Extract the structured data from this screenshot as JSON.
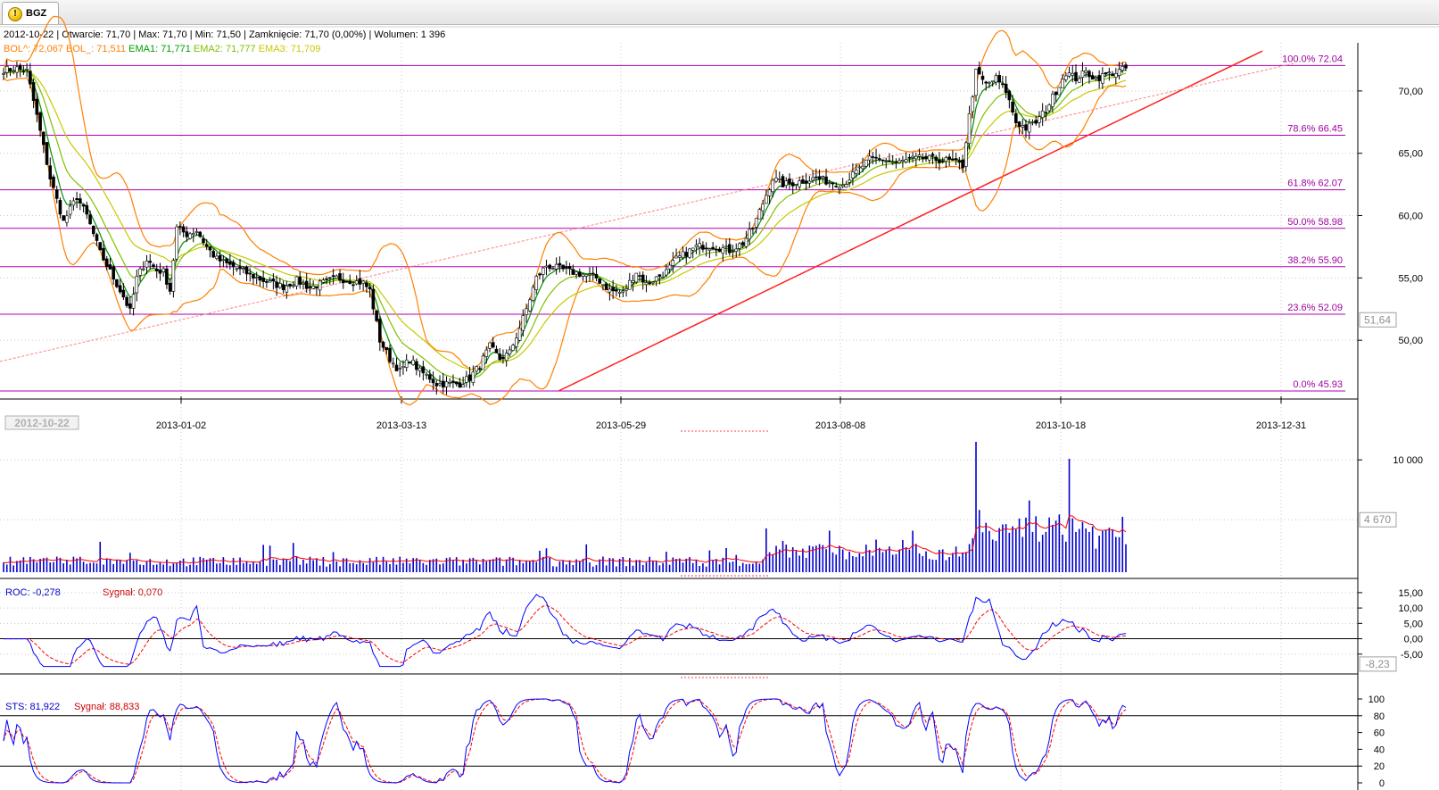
{
  "tab": {
    "label": "BGZ",
    "icon": "warning-icon"
  },
  "quote_line": "2012-10-22 | Otwarcie: 71,70 | Max: 71,70 | Min: 71,50 | Zamknięcie: 71,70 (0,00%) | Wolumen: 1 396",
  "indicators": [
    {
      "text": "BOL^: 72,067",
      "color": "#ff8000"
    },
    {
      "text": "BOL_: 71,511",
      "color": "#ff8000"
    },
    {
      "text": "EMA1: 71,771",
      "color": "#00a000"
    },
    {
      "text": "EMA2: 71,777",
      "color": "#80c000"
    },
    {
      "text": "EMA3: 71,709",
      "color": "#c8c800"
    }
  ],
  "roc_legend": {
    "roc": "ROC: -0,278",
    "signal": "Sygnał: 0,070"
  },
  "sts_legend": {
    "sts": "STS: 81,922",
    "signal": "Sygnał: 88,833"
  },
  "date_badge": "2012-10-22",
  "chart_data": [
    {
      "type": "candlestick",
      "title": "BGZ",
      "x_tick_labels": [
        "2013-01-02",
        "2013-03-13",
        "2013-05-29",
        "2013-08-08",
        "2013-10-18",
        "2013-12-31"
      ],
      "y_tick_labels": [
        "50,00",
        "55,00",
        "60,00",
        "65,00",
        "70,00"
      ],
      "ylim": [
        45.5,
        73.5
      ],
      "current_value_label": "51,64",
      "current_value": 51.64,
      "fibonacci_levels": [
        {
          "label": "100.0% 72.04",
          "value": 72.04
        },
        {
          "label": "78.6% 66.45",
          "value": 66.45
        },
        {
          "label": "61.8% 62.07",
          "value": 62.07
        },
        {
          "label": "50.0% 58.98",
          "value": 58.98
        },
        {
          "label": "38.2% 55.90",
          "value": 55.9
        },
        {
          "label": "23.6% 52.09",
          "value": 52.09
        },
        {
          "label": "0.0% 45.93",
          "value": 45.93
        }
      ],
      "close_keypoints": [
        [
          0,
          71.7
        ],
        [
          4,
          71.8
        ],
        [
          7,
          71.6
        ],
        [
          10,
          68
        ],
        [
          14,
          63
        ],
        [
          18,
          59.5
        ],
        [
          22,
          61.5
        ],
        [
          25,
          60
        ],
        [
          29,
          57
        ],
        [
          32,
          55.5
        ],
        [
          36,
          53.5
        ],
        [
          38,
          52.3
        ],
        [
          40,
          55
        ],
        [
          43,
          56.5
        ],
        [
          46,
          55.6
        ],
        [
          48,
          55.5
        ],
        [
          50,
          54
        ],
        [
          52,
          59
        ],
        [
          55,
          58.5
        ],
        [
          58,
          58.8
        ],
        [
          61,
          57.5
        ],
        [
          64,
          56.5
        ],
        [
          68,
          56
        ],
        [
          72,
          55.5
        ],
        [
          76,
          55
        ],
        [
          80,
          54.6
        ],
        [
          84,
          54.3
        ],
        [
          88,
          54.8
        ],
        [
          92,
          54.2
        ],
        [
          96,
          54.6
        ],
        [
          100,
          55
        ],
        [
          104,
          54.8
        ],
        [
          108,
          54.6
        ],
        [
          110,
          54
        ],
        [
          113,
          50
        ],
        [
          116,
          48.5
        ],
        [
          119,
          47.5
        ],
        [
          122,
          48.5
        ],
        [
          125,
          47.5
        ],
        [
          128,
          47
        ],
        [
          130,
          46.5
        ],
        [
          134,
          46.5
        ],
        [
          137,
          46.5
        ],
        [
          140,
          47
        ],
        [
          143,
          48
        ],
        [
          146,
          49.5
        ],
        [
          149,
          48.5
        ],
        [
          152,
          49
        ],
        [
          155,
          51
        ],
        [
          157,
          52.5
        ],
        [
          160,
          55
        ],
        [
          163,
          56
        ],
        [
          166,
          55.8
        ],
        [
          170,
          55.5
        ],
        [
          174,
          55.3
        ],
        [
          178,
          55
        ],
        [
          182,
          54
        ],
        [
          186,
          53.8
        ],
        [
          190,
          55.5
        ],
        [
          193,
          54.5
        ],
        [
          196,
          55
        ],
        [
          199,
          55.5
        ],
        [
          202,
          56.5
        ],
        [
          205,
          57
        ],
        [
          208,
          57.5
        ],
        [
          211,
          57.6
        ],
        [
          214,
          57.5
        ],
        [
          218,
          57.2
        ],
        [
          222,
          57.8
        ],
        [
          225,
          59
        ],
        [
          228,
          61
        ],
        [
          231,
          63
        ],
        [
          234,
          62.5
        ],
        [
          237,
          62.6
        ],
        [
          240,
          62.8
        ],
        [
          244,
          63
        ],
        [
          248,
          62.7
        ],
        [
          252,
          62.5
        ],
        [
          256,
          63.5
        ],
        [
          260,
          64.5
        ],
        [
          264,
          64.5
        ],
        [
          268,
          64.2
        ],
        [
          272,
          64.5
        ],
        [
          276,
          64.6
        ],
        [
          280,
          64.5
        ],
        [
          284,
          64.4
        ],
        [
          288,
          64
        ],
        [
          290,
          68
        ],
        [
          292,
          71.5
        ],
        [
          295,
          70.5
        ],
        [
          298,
          71
        ],
        [
          301,
          70
        ],
        [
          304,
          67.5
        ],
        [
          307,
          67
        ],
        [
          310,
          67.5
        ],
        [
          313,
          68.5
        ],
        [
          316,
          70
        ],
        [
          319,
          71.5
        ],
        [
          322,
          71
        ],
        [
          325,
          71.5
        ],
        [
          328,
          71
        ],
        [
          331,
          71.3
        ],
        [
          334,
          71.5
        ],
        [
          337,
          71.8
        ]
      ],
      "n_bars": 338,
      "volume": {
        "y_tick_labels": [
          "10 000"
        ],
        "current_value_label": "4 670",
        "ylim": [
          0,
          12000
        ]
      },
      "roc": {
        "y_tick_labels": [
          "15,00",
          "10,00",
          "5,00",
          "0,00",
          "-5,00"
        ],
        "current_value_label": "-8,23",
        "ylim": [
          -10,
          17
        ]
      },
      "sts": {
        "y_tick_labels": [
          "100",
          "80",
          "60",
          "40",
          "20",
          "0"
        ],
        "reference_levels": [
          80,
          20
        ],
        "ylim": [
          0,
          100
        ]
      }
    }
  ]
}
